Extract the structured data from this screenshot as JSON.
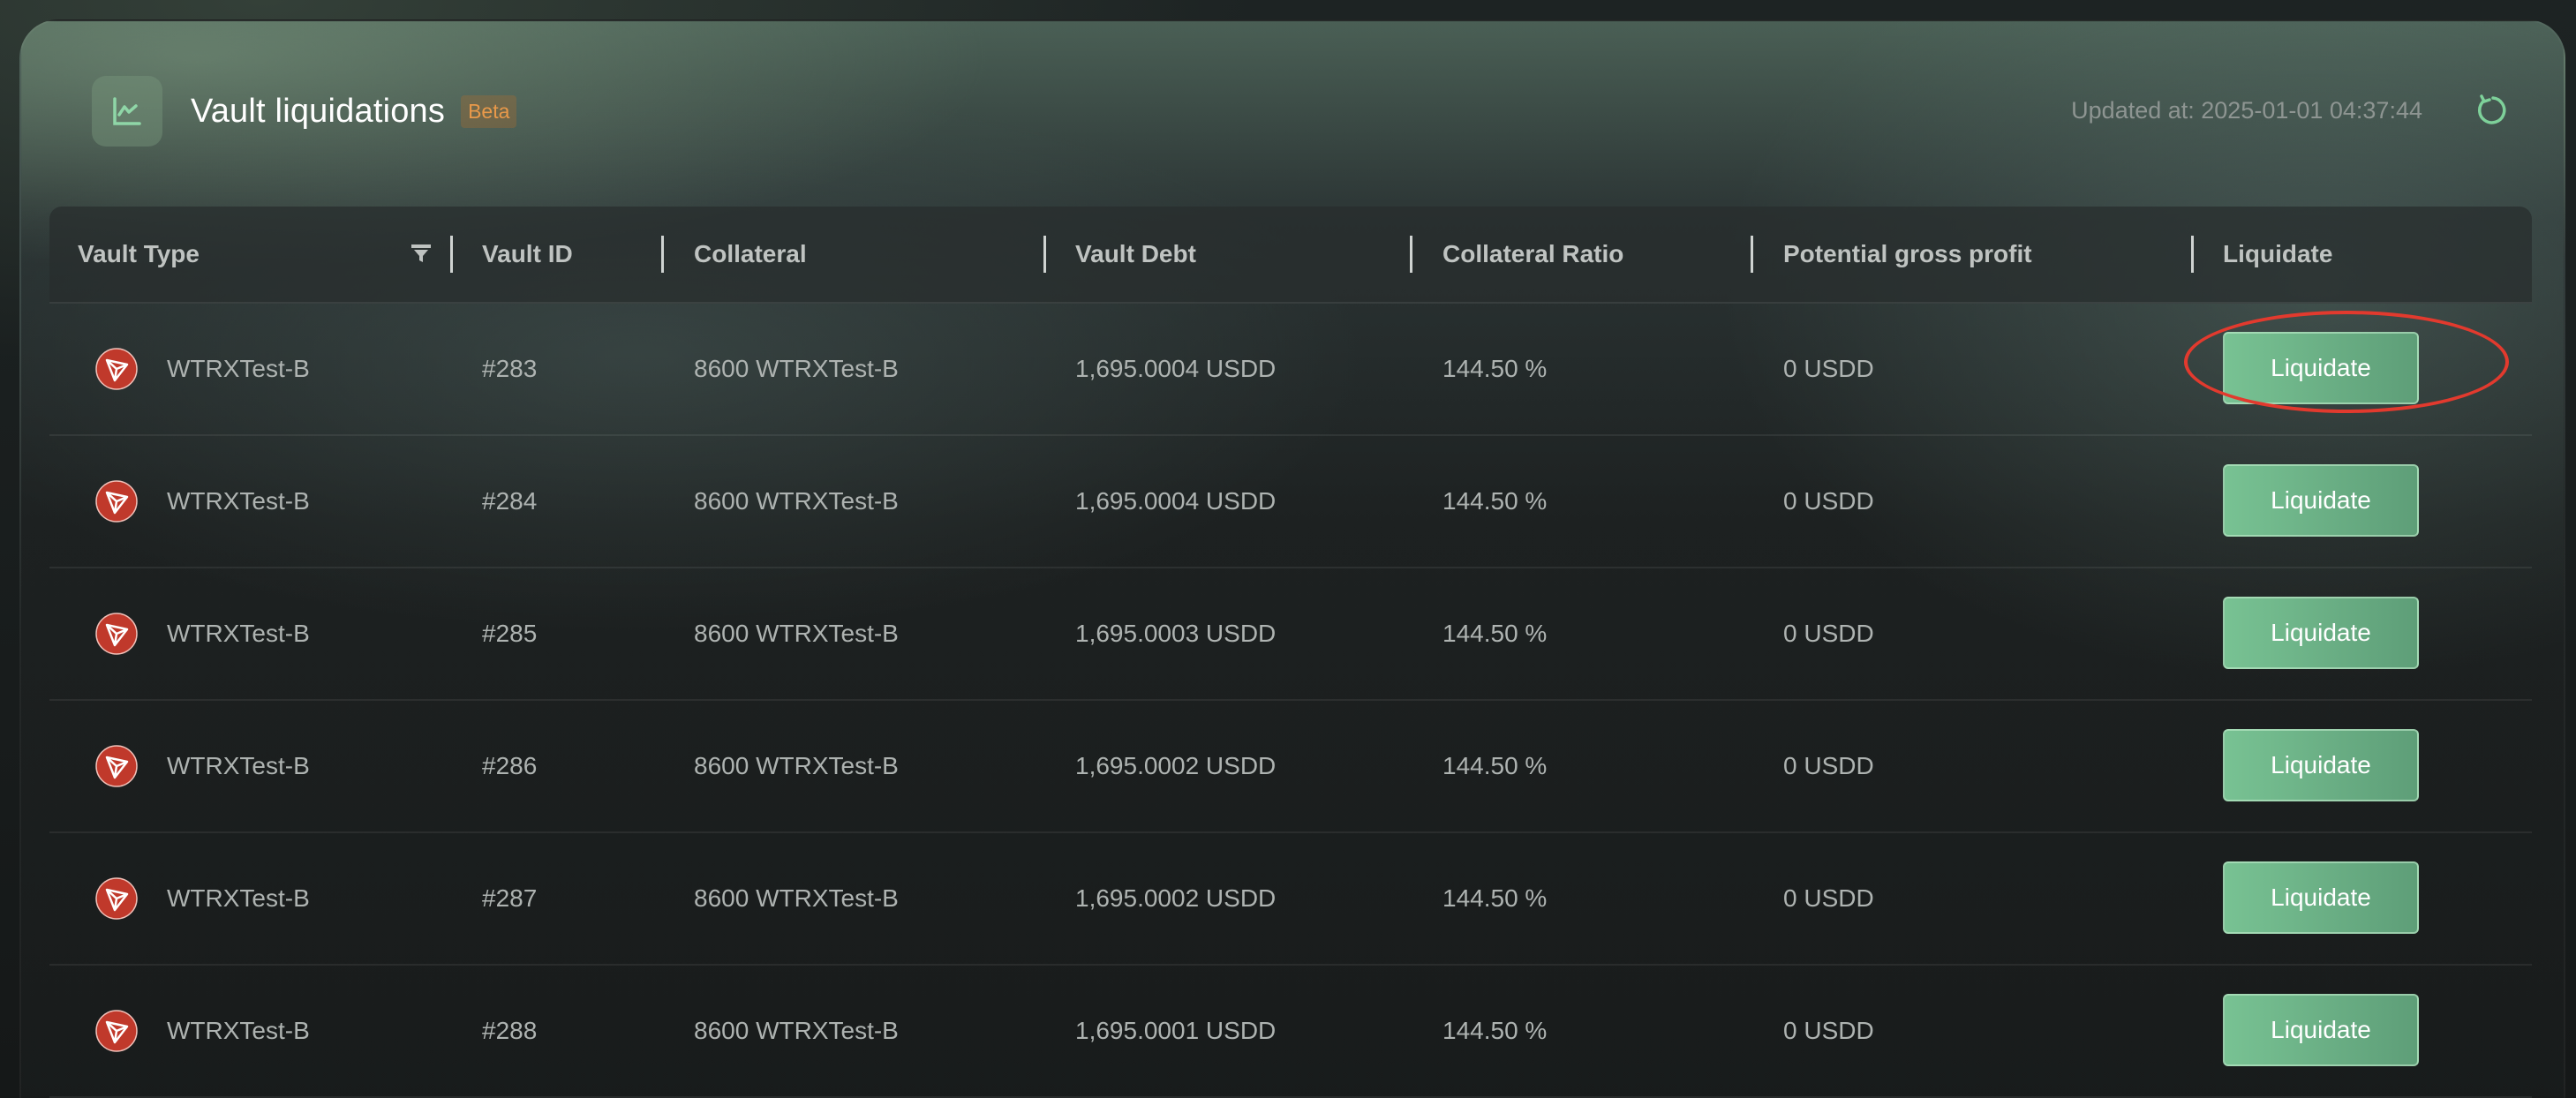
{
  "header": {
    "title": "Vault liquidations",
    "badge": "Beta",
    "updated_label": "Updated at: 2025-01-01 04:37:44"
  },
  "columns": [
    "Vault Type",
    "Vault ID",
    "Collateral",
    "Vault Debt",
    "Collateral Ratio",
    "Potential gross profit",
    "Liquidate"
  ],
  "rows": [
    {
      "type": "WTRXTest-B",
      "id": "#283",
      "collateral": "8600 WTRXTest-B",
      "debt": "1,695.0004 USDD",
      "ratio": "144.50 %",
      "profit": "0 USDD",
      "action": "Liquidate"
    },
    {
      "type": "WTRXTest-B",
      "id": "#284",
      "collateral": "8600 WTRXTest-B",
      "debt": "1,695.0004 USDD",
      "ratio": "144.50 %",
      "profit": "0 USDD",
      "action": "Liquidate"
    },
    {
      "type": "WTRXTest-B",
      "id": "#285",
      "collateral": "8600 WTRXTest-B",
      "debt": "1,695.0003 USDD",
      "ratio": "144.50 %",
      "profit": "0 USDD",
      "action": "Liquidate"
    },
    {
      "type": "WTRXTest-B",
      "id": "#286",
      "collateral": "8600 WTRXTest-B",
      "debt": "1,695.0002 USDD",
      "ratio": "144.50 %",
      "profit": "0 USDD",
      "action": "Liquidate"
    },
    {
      "type": "WTRXTest-B",
      "id": "#287",
      "collateral": "8600 WTRXTest-B",
      "debt": "1,695.0002 USDD",
      "ratio": "144.50 %",
      "profit": "0 USDD",
      "action": "Liquidate"
    },
    {
      "type": "WTRXTest-B",
      "id": "#288",
      "collateral": "8600 WTRXTest-B",
      "debt": "1,695.0001 USDD",
      "ratio": "144.50 %",
      "profit": "0 USDD",
      "action": "Liquidate"
    }
  ],
  "icons": {
    "header": "chart-icon",
    "refresh": "refresh-icon",
    "filter": "filter-icon",
    "token": "tron-icon"
  },
  "colors": {
    "accent": "#78c293",
    "badge": "#e8994a",
    "token": "#c0392b",
    "highlight": "#e23a2e"
  }
}
